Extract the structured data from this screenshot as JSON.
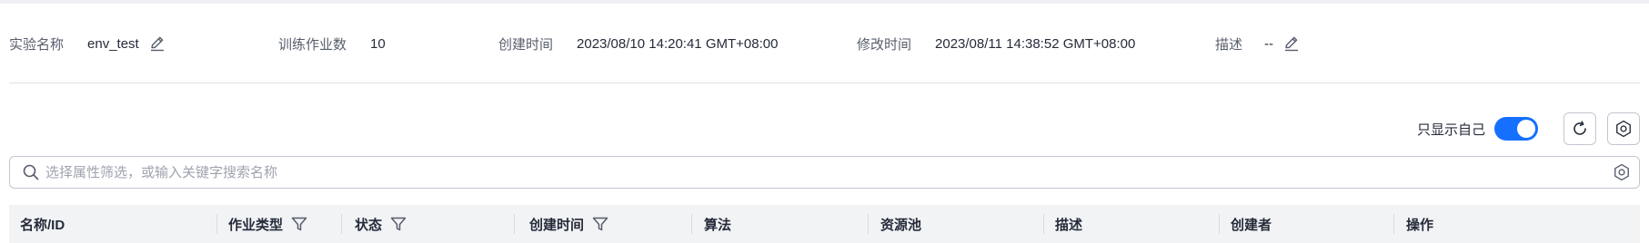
{
  "experiment": {
    "name_label": "实验名称",
    "name_value": "env_test",
    "jobs_label": "训练作业数",
    "jobs_value": "10",
    "created_label": "创建时间",
    "created_value": "2023/08/10 14:20:41 GMT+08:00",
    "modified_label": "修改时间",
    "modified_value": "2023/08/11 14:38:52 GMT+08:00",
    "desc_label": "描述",
    "desc_value": "--"
  },
  "toolbar": {
    "show_self_label": "只显示自己",
    "show_self_on": true,
    "refresh_icon": "refresh-icon",
    "settings_icon": "gear-icon"
  },
  "search": {
    "placeholder": "选择属性筛选，或输入关键字搜索名称",
    "value": ""
  },
  "table": {
    "columns": [
      {
        "label": "名称/ID",
        "filter": false
      },
      {
        "label": "作业类型",
        "filter": true
      },
      {
        "label": "状态",
        "filter": true
      },
      {
        "label": "创建时间",
        "filter": true
      },
      {
        "label": "算法",
        "filter": false
      },
      {
        "label": "资源池",
        "filter": false
      },
      {
        "label": "描述",
        "filter": false
      },
      {
        "label": "创建者",
        "filter": false
      },
      {
        "label": "操作",
        "filter": false
      }
    ]
  },
  "colors": {
    "accent": "#1570ff",
    "header_bg": "#f2f3f5",
    "text_primary": "#252b3a",
    "text_secondary": "#575d6c",
    "border": "#c2c6d0"
  }
}
